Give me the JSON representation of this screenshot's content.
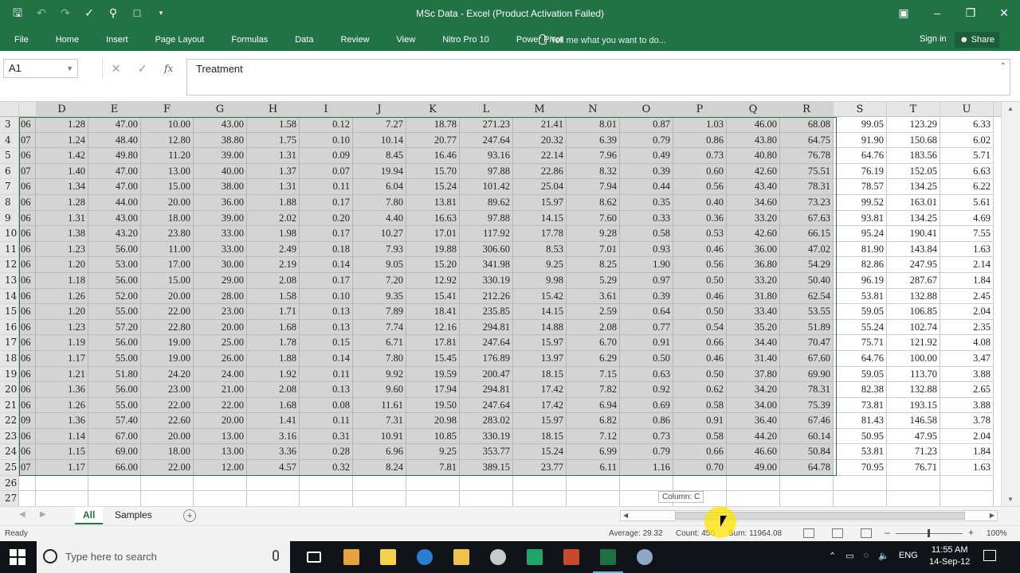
{
  "window": {
    "title": "MSc Data - Excel (Product Activation Failed)"
  },
  "ribbon": {
    "tabs": [
      "File",
      "Home",
      "Insert",
      "Page Layout",
      "Formulas",
      "Data",
      "Review",
      "View",
      "Nitro Pro 10",
      "Power Pivot"
    ],
    "tell_me": "Tell me what you want to do...",
    "sign_in": "Sign in",
    "share": "Share"
  },
  "formula_bar": {
    "name_box": "A1",
    "content": "Treatment"
  },
  "grid": {
    "columns": [
      "D",
      "E",
      "F",
      "G",
      "H",
      "I",
      "J",
      "K",
      "L",
      "M",
      "N",
      "O",
      "P",
      "Q",
      "R",
      "S",
      "T",
      "U"
    ],
    "selected_columns": [
      "D",
      "E",
      "F",
      "G",
      "H",
      "I",
      "J",
      "K",
      "L",
      "M",
      "N",
      "O",
      "P",
      "Q",
      "R"
    ],
    "rows": [
      {
        "n": "3",
        "a": "06",
        "v": [
          "1.28",
          "47.00",
          "10.00",
          "43.00",
          "1.58",
          "0.12",
          "7.27",
          "18.78",
          "271.23",
          "21.41",
          "8.01",
          "0.87",
          "1.03",
          "46.00",
          "68.08",
          "99.05",
          "123.29",
          "6.33"
        ]
      },
      {
        "n": "4",
        "a": "07",
        "v": [
          "1.24",
          "48.40",
          "12.80",
          "38.80",
          "1.75",
          "0.10",
          "10.14",
          "20.77",
          "247.64",
          "20.32",
          "6.39",
          "0.79",
          "0.86",
          "43.80",
          "64.75",
          "91.90",
          "150.68",
          "6.02"
        ]
      },
      {
        "n": "5",
        "a": "06",
        "v": [
          "1.42",
          "49.80",
          "11.20",
          "39.00",
          "1.31",
          "0.09",
          "8.45",
          "16.46",
          "93.16",
          "22.14",
          "7.96",
          "0.49",
          "0.73",
          "40.80",
          "76.78",
          "64.76",
          "183.56",
          "5.71"
        ]
      },
      {
        "n": "6",
        "a": "07",
        "v": [
          "1.40",
          "47.00",
          "13.00",
          "40.00",
          "1.37",
          "0.07",
          "19.94",
          "15.70",
          "97.88",
          "22.86",
          "8.32",
          "0.39",
          "0.60",
          "42.60",
          "75.51",
          "76.19",
          "152.05",
          "6.63"
        ]
      },
      {
        "n": "7",
        "a": "06",
        "v": [
          "1.34",
          "47.00",
          "15.00",
          "38.00",
          "1.31",
          "0.11",
          "6.04",
          "15.24",
          "101.42",
          "25.04",
          "7.94",
          "0.44",
          "0.56",
          "43.40",
          "78.31",
          "78.57",
          "134.25",
          "6.22"
        ]
      },
      {
        "n": "8",
        "a": "06",
        "v": [
          "1.28",
          "44.00",
          "20.00",
          "36.00",
          "1.88",
          "0.17",
          "7.80",
          "13.81",
          "89.62",
          "15.97",
          "8.62",
          "0.35",
          "0.40",
          "34.60",
          "73.23",
          "99.52",
          "163.01",
          "5.61"
        ]
      },
      {
        "n": "9",
        "a": "06",
        "v": [
          "1.31",
          "43.00",
          "18.00",
          "39.00",
          "2.02",
          "0.20",
          "4.40",
          "16.63",
          "97.88",
          "14.15",
          "7.60",
          "0.33",
          "0.36",
          "33.20",
          "67.63",
          "93.81",
          "134.25",
          "4.69"
        ]
      },
      {
        "n": "10",
        "a": "06",
        "v": [
          "1.38",
          "43.20",
          "23.80",
          "33.00",
          "1.98",
          "0.17",
          "10.27",
          "17.01",
          "117.92",
          "17.78",
          "9.28",
          "0.58",
          "0.53",
          "42.60",
          "66.15",
          "95.24",
          "190.41",
          "7.55"
        ]
      },
      {
        "n": "11",
        "a": "06",
        "v": [
          "1.23",
          "56.00",
          "11.00",
          "33.00",
          "2.49",
          "0.18",
          "7.93",
          "19.88",
          "306.60",
          "8.53",
          "7.01",
          "0.93",
          "0.46",
          "36.00",
          "47.02",
          "81.90",
          "143.84",
          "1.63"
        ]
      },
      {
        "n": "12",
        "a": "06",
        "v": [
          "1.20",
          "53.00",
          "17.00",
          "30.00",
          "2.19",
          "0.14",
          "9.05",
          "15.20",
          "341.98",
          "9.25",
          "8.25",
          "1.90",
          "0.56",
          "36.80",
          "54.29",
          "82.86",
          "247.95",
          "2.14"
        ]
      },
      {
        "n": "13",
        "a": "06",
        "v": [
          "1.18",
          "56.00",
          "15.00",
          "29.00",
          "2.08",
          "0.17",
          "7.20",
          "12.92",
          "330.19",
          "9.98",
          "5.29",
          "0.97",
          "0.50",
          "33.20",
          "50.40",
          "96.19",
          "287.67",
          "1.84"
        ]
      },
      {
        "n": "14",
        "a": "06",
        "v": [
          "1.26",
          "52.00",
          "20.00",
          "28.00",
          "1.58",
          "0.10",
          "9.35",
          "15.41",
          "212.26",
          "15.42",
          "3.61",
          "0.39",
          "0.46",
          "31.80",
          "62.54",
          "53.81",
          "132.88",
          "2.45"
        ]
      },
      {
        "n": "15",
        "a": "06",
        "v": [
          "1.20",
          "55.00",
          "22.00",
          "23.00",
          "1.71",
          "0.13",
          "7.89",
          "18.41",
          "235.85",
          "14.15",
          "2.59",
          "0.64",
          "0.50",
          "33.40",
          "53.55",
          "59.05",
          "106.85",
          "2.04"
        ]
      },
      {
        "n": "16",
        "a": "06",
        "v": [
          "1.23",
          "57.20",
          "22.80",
          "20.00",
          "1.68",
          "0.13",
          "7.74",
          "12.16",
          "294.81",
          "14.88",
          "2.08",
          "0.77",
          "0.54",
          "35.20",
          "51.89",
          "55.24",
          "102.74",
          "2.35"
        ]
      },
      {
        "n": "17",
        "a": "06",
        "v": [
          "1.19",
          "56.00",
          "19.00",
          "25.00",
          "1.78",
          "0.15",
          "6.71",
          "17.81",
          "247.64",
          "15.97",
          "6.70",
          "0.91",
          "0.66",
          "34.40",
          "70.47",
          "75.71",
          "121.92",
          "4.08"
        ]
      },
      {
        "n": "18",
        "a": "06",
        "v": [
          "1.17",
          "55.00",
          "19.00",
          "26.00",
          "1.88",
          "0.14",
          "7.80",
          "15.45",
          "176.89",
          "13.97",
          "6.29",
          "0.50",
          "0.46",
          "31.40",
          "67.60",
          "64.76",
          "100.00",
          "3.47"
        ]
      },
      {
        "n": "19",
        "a": "06",
        "v": [
          "1.21",
          "51.80",
          "24.20",
          "24.00",
          "1.92",
          "0.11",
          "9.92",
          "19.59",
          "200.47",
          "18.15",
          "7.15",
          "0.63",
          "0.50",
          "37.80",
          "69.90",
          "59.05",
          "113.70",
          "3.88"
        ]
      },
      {
        "n": "20",
        "a": "06",
        "v": [
          "1.36",
          "56.00",
          "23.00",
          "21.00",
          "2.08",
          "0.13",
          "9.60",
          "17.94",
          "294.81",
          "17.42",
          "7.82",
          "0.92",
          "0.62",
          "34.20",
          "78.31",
          "82.38",
          "132.88",
          "2.65"
        ]
      },
      {
        "n": "21",
        "a": "06",
        "v": [
          "1.26",
          "55.00",
          "22.00",
          "22.00",
          "1.68",
          "0.08",
          "11.61",
          "19.50",
          "247.64",
          "17.42",
          "6.94",
          "0.69",
          "0.58",
          "34.00",
          "75.39",
          "73.81",
          "193.15",
          "3.88"
        ]
      },
      {
        "n": "22",
        "a": "09",
        "v": [
          "1.36",
          "57.40",
          "22.60",
          "20.00",
          "1.41",
          "0.11",
          "7.31",
          "20.98",
          "283.02",
          "15.97",
          "6.82",
          "0.86",
          "0.91",
          "36.40",
          "67.46",
          "81.43",
          "146.58",
          "3.78"
        ]
      },
      {
        "n": "23",
        "a": "06",
        "v": [
          "1.14",
          "67.00",
          "20.00",
          "13.00",
          "3.16",
          "0.31",
          "10.91",
          "10.85",
          "330.19",
          "18.15",
          "7.12",
          "0.73",
          "0.58",
          "44.20",
          "60.14",
          "50.95",
          "47.95",
          "2.04"
        ]
      },
      {
        "n": "24",
        "a": "06",
        "v": [
          "1.15",
          "69.00",
          "18.00",
          "13.00",
          "3.36",
          "0.28",
          "6.96",
          "9.25",
          "353.77",
          "15.24",
          "6.99",
          "0.79",
          "0.66",
          "46.60",
          "50.84",
          "53.81",
          "71.23",
          "1.84"
        ]
      },
      {
        "n": "25",
        "a": "07",
        "v": [
          "1.17",
          "66.00",
          "22.00",
          "12.00",
          "4.57",
          "0.32",
          "8.24",
          "7.81",
          "389.15",
          "23.77",
          "6.11",
          "1.16",
          "0.70",
          "49.00",
          "64.78",
          "70.95",
          "76.71",
          "1.63"
        ]
      },
      {
        "n": "26",
        "a": "",
        "v": []
      },
      {
        "n": "27",
        "a": "",
        "v": []
      }
    ]
  },
  "tooltip": "Column: C",
  "sheets": {
    "tabs": [
      "All",
      "Samples"
    ],
    "active": "All"
  },
  "status": {
    "ready": "Ready",
    "average": "Average: 29.32",
    "count": "Count: 450",
    "sum": "Sum: 11964.08",
    "zoom": "100%"
  },
  "taskbar": {
    "search_placeholder": "Type here to search",
    "language": "ENG",
    "time": "11:55 AM",
    "date": "14-Sep-12"
  },
  "colors": {
    "accent": "#217346",
    "selection": "#d4d4d4"
  }
}
